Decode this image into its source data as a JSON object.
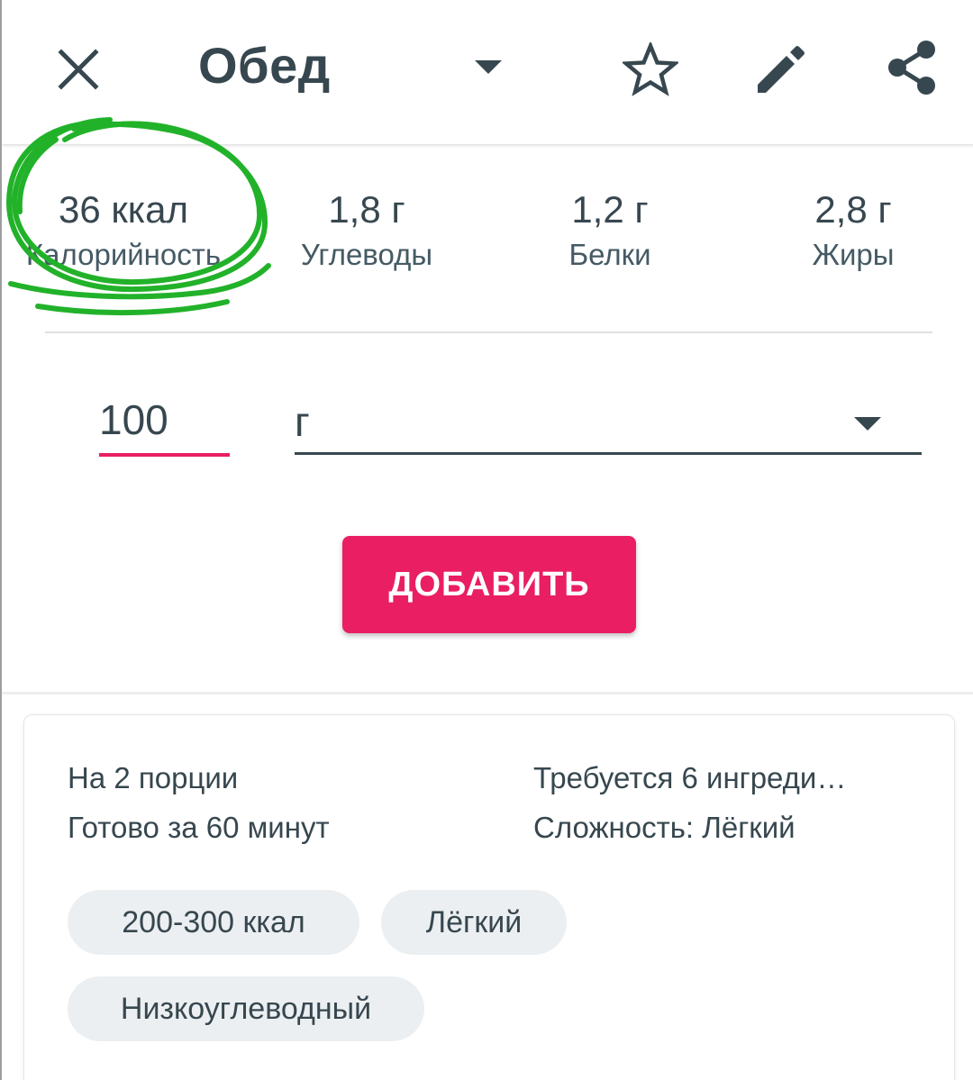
{
  "header": {
    "title": "Обед",
    "icons": {
      "close": "close-icon",
      "caret": "caret-down-icon",
      "favorite": "star-outline-icon",
      "edit": "pencil-icon",
      "share": "share-icon"
    }
  },
  "nutrition": {
    "calories": {
      "value": "36 ккал",
      "label": "Калорийность"
    },
    "carbs": {
      "value": "1,8 г",
      "label": "Углеводы"
    },
    "protein": {
      "value": "1,2 г",
      "label": "Белки"
    },
    "fat": {
      "value": "2,8 г",
      "label": "Жиры"
    }
  },
  "portion": {
    "amount": "100",
    "unit": "г"
  },
  "add_button": "ДОБАВИТЬ",
  "recipe": {
    "servings": "На 2 порции",
    "time": "Готово за 60 минут",
    "ingredients": "Требуется 6 ингреди…",
    "difficulty": "Сложность: Лёгкий",
    "tags": [
      "200-300 ккал",
      "Лёгкий",
      "Низкоуглеводный"
    ]
  },
  "colors": {
    "accent": "#e91e63",
    "text": "#37474f",
    "chip_bg": "#eceff1",
    "annotation": "#22b22a"
  }
}
